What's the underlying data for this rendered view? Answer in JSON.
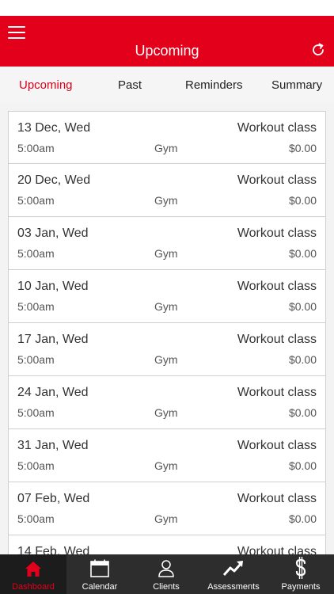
{
  "header": {
    "title": "Upcoming",
    "menu_icon": "hamburger-menu-icon",
    "refresh_icon": "refresh-icon",
    "brand_color": "#e3001b"
  },
  "tabs": [
    {
      "label": "Upcoming",
      "active": true
    },
    {
      "label": "Past",
      "active": false
    },
    {
      "label": "Reminders",
      "active": false
    },
    {
      "label": "Summary",
      "active": false
    }
  ],
  "sessions": [
    {
      "date": "13 Dec, Wed",
      "type": "Workout class",
      "time": "5:00am",
      "place": "Gym",
      "price": "$0.00"
    },
    {
      "date": "20 Dec, Wed",
      "type": "Workout class",
      "time": "5:00am",
      "place": "Gym",
      "price": "$0.00"
    },
    {
      "date": "03 Jan, Wed",
      "type": "Workout class",
      "time": "5:00am",
      "place": "Gym",
      "price": "$0.00"
    },
    {
      "date": "10 Jan, Wed",
      "type": "Workout class",
      "time": "5:00am",
      "place": "Gym",
      "price": "$0.00"
    },
    {
      "date": "17 Jan, Wed",
      "type": "Workout class",
      "time": "5:00am",
      "place": "Gym",
      "price": "$0.00"
    },
    {
      "date": "24 Jan, Wed",
      "type": "Workout class",
      "time": "5:00am",
      "place": "Gym",
      "price": "$0.00"
    },
    {
      "date": "31 Jan, Wed",
      "type": "Workout class",
      "time": "5:00am",
      "place": "Gym",
      "price": "$0.00"
    },
    {
      "date": "07 Feb, Wed",
      "type": "Workout class",
      "time": "5:00am",
      "place": "Gym",
      "price": "$0.00"
    },
    {
      "date": "14 Feb, Wed",
      "type": "Workout class",
      "time": "",
      "place": "",
      "price": ""
    }
  ],
  "bottom_nav": [
    {
      "label": "Dashboard",
      "icon": "home-icon",
      "active": true
    },
    {
      "label": "Calendar",
      "icon": "calendar-icon",
      "active": false
    },
    {
      "label": "Clients",
      "icon": "person-icon",
      "active": false
    },
    {
      "label": "Assessments",
      "icon": "trending-up-icon",
      "active": false
    },
    {
      "label": "Payments",
      "icon": "dollar-icon",
      "active": false
    }
  ]
}
